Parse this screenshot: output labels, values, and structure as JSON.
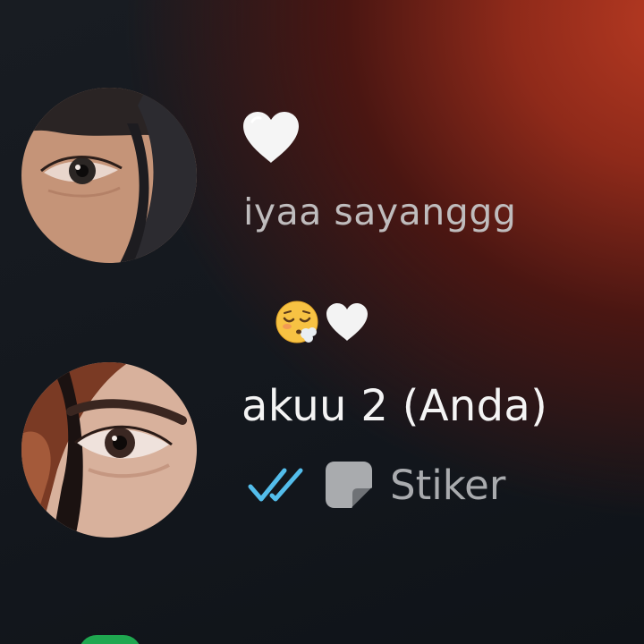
{
  "chats": [
    {
      "avatar_icon": "profile-photo-eye",
      "preview_emoji": "white-heart",
      "last_message": "iyaa sayanggg"
    },
    {
      "avatar_icon": "profile-photo-eye",
      "header_emojis": [
        "face-exhaling",
        "white-heart"
      ],
      "name": "akuu 2 (Anda)",
      "read_status_icon": "double-check-read-icon",
      "read_status_color": "#53bdeb",
      "last_message_type_icon": "sticker-icon",
      "last_message_type": "Stiker"
    }
  ],
  "colors": {
    "background_dark": "#13171d",
    "background_accent": "#b83a22",
    "text_primary": "#f4f4f4",
    "text_secondary": "#bfbcbd",
    "online_indicator": "#1fa750"
  }
}
